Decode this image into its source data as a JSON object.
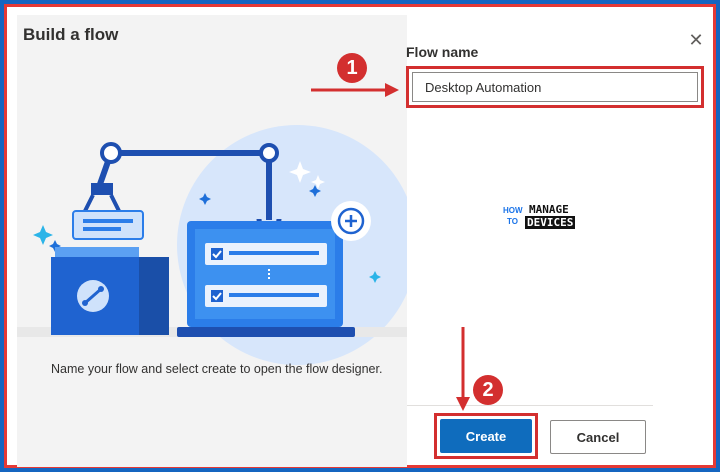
{
  "dialog": {
    "title": "Build a flow",
    "close_symbol": "✕",
    "caption": "Name your flow and select create to open the flow designer."
  },
  "form": {
    "flow_name_label": "Flow name",
    "flow_name_value": "Desktop Automation"
  },
  "buttons": {
    "create_label": "Create",
    "cancel_label": "Cancel"
  },
  "annotations": {
    "step1": "1",
    "step2": "2"
  },
  "watermark": {
    "how": "HOW",
    "to": "TO",
    "manage": "MANAGE",
    "devices": "DEVICES"
  },
  "colors": {
    "accent": "#0f6cbd",
    "annotation_red": "#d32f2f",
    "outer_background": "#1565c0"
  },
  "icons": {
    "illustration": "robotic-arm-laptop-illustration",
    "close": "close-icon"
  }
}
